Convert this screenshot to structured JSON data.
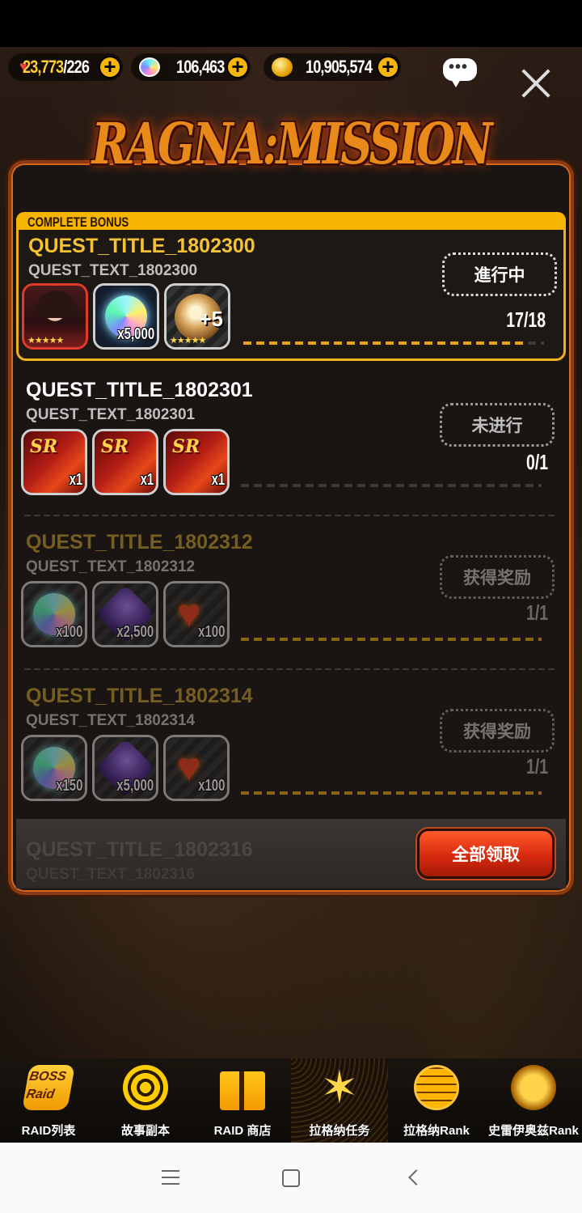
{
  "topbar": {
    "stamina": "23,773",
    "stamina_max": "/226",
    "gems": "106,463",
    "gold": "10,905,574"
  },
  "title": "RAGNA:MISSION",
  "bonus_tab_label": "COMPLETE BONUS",
  "quests": [
    {
      "title": "QUEST_TITLE_1802300",
      "text": "QUEST_TEXT_1802300",
      "status": "進行中",
      "progress": "17/18",
      "progress_fraction": 0.94,
      "rewards": [
        {
          "icon": "hero-portrait",
          "qty": "",
          "stars": "★★★★★"
        },
        {
          "icon": "rainbow-gem-icon",
          "qty": "x5,000",
          "stars": ""
        },
        {
          "icon": "enhance-orb-icon",
          "qty": "+5",
          "stars": "★★★★★"
        }
      ]
    },
    {
      "title": "QUEST_TITLE_1802301",
      "text": "QUEST_TEXT_1802301",
      "status": "未进行",
      "progress": "0/1",
      "progress_fraction": 0,
      "rewards": [
        {
          "icon": "sr-ticket-icon",
          "qty": "x1"
        },
        {
          "icon": "sr-ticket-icon",
          "qty": "x1"
        },
        {
          "icon": "sr-ticket-icon",
          "qty": "x1"
        }
      ]
    },
    {
      "title": "QUEST_TITLE_1802312",
      "text": "QUEST_TEXT_1802312",
      "status": "获得奖励",
      "progress": "1/1",
      "progress_fraction": 1,
      "rewards": [
        {
          "icon": "rainbow-gem-icon",
          "qty": "x100"
        },
        {
          "icon": "dark-gem-icon",
          "qty": "x2,500"
        },
        {
          "icon": "heart-icon",
          "qty": "x100"
        }
      ]
    },
    {
      "title": "QUEST_TITLE_1802314",
      "text": "QUEST_TEXT_1802314",
      "status": "获得奖励",
      "progress": "1/1",
      "progress_fraction": 1,
      "rewards": [
        {
          "icon": "rainbow-gem-icon",
          "qty": "x150"
        },
        {
          "icon": "dark-gem-icon",
          "qty": "x5,000"
        },
        {
          "icon": "heart-icon",
          "qty": "x100"
        }
      ]
    }
  ],
  "peek_quest": {
    "title": "QUEST_TITLE_1802316",
    "text": "QUEST_TEXT_1802316"
  },
  "claim_all_label": "全部领取",
  "nav": [
    {
      "label": "RAID列表",
      "icon": "boss-raid-icon"
    },
    {
      "label": "故事副本",
      "icon": "story-icon"
    },
    {
      "label": "RAID 商店",
      "icon": "gift-icon"
    },
    {
      "label": "拉格纳任务",
      "icon": "mission-icon"
    },
    {
      "label": "拉格纳Rank",
      "icon": "rank-globe-icon"
    },
    {
      "label": "史雷伊奥兹Rank",
      "icon": "slayers-icon"
    }
  ],
  "colors": {
    "accent": "#f4b400",
    "claim_button": "#d72a10"
  }
}
